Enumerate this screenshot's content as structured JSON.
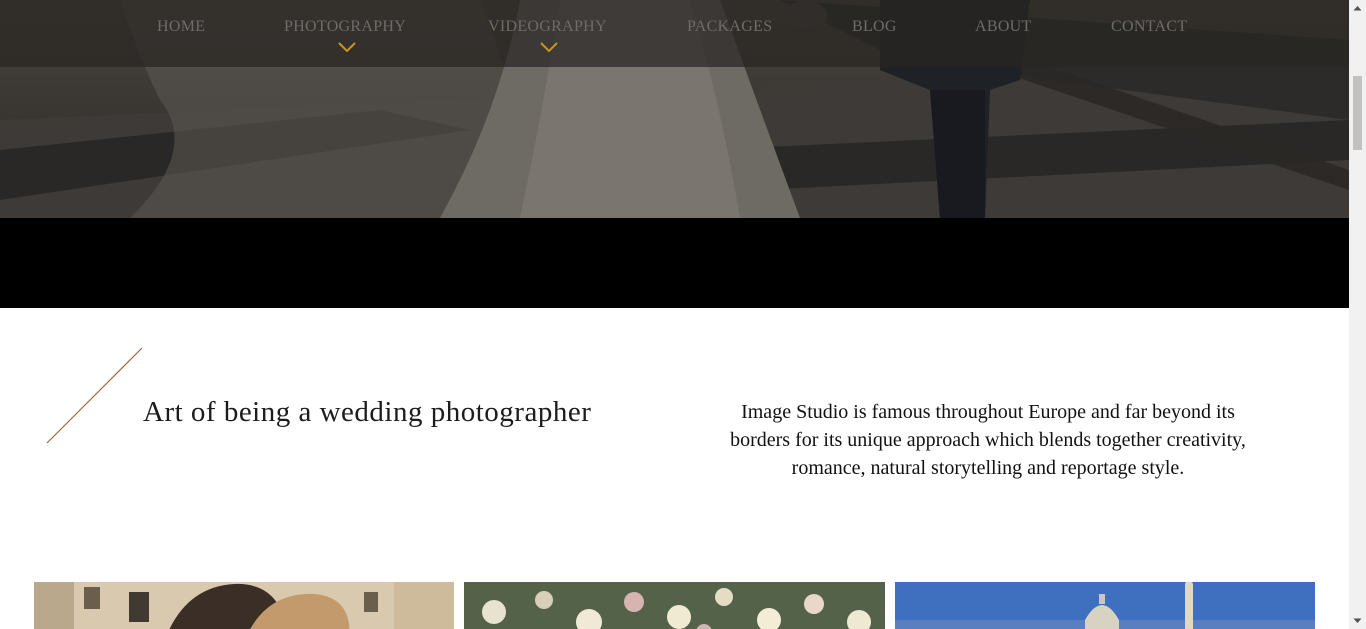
{
  "nav": {
    "items": [
      {
        "label": "HOME"
      },
      {
        "label": "PHOTOGRAPHY"
      },
      {
        "label": "VIDEOGRAPHY"
      },
      {
        "label": "PACKAGES"
      },
      {
        "label": "BLOG"
      },
      {
        "label": "ABOUT"
      },
      {
        "label": "CONTACT"
      }
    ],
    "dropdown_icon": "chevron-down-icon",
    "accent_color": "#c8941f"
  },
  "intro": {
    "title": "Art of being a wedding photographer",
    "text": "Image Studio is famous throughout Europe and far beyond its borders for its unique approach which blends together creativity, romance, natural storytelling and reportage style.",
    "line_color": "#9a6a3e"
  },
  "gallery": {
    "items": [
      "couple-photo",
      "flowers-photo",
      "rome-cathedral-photo"
    ]
  }
}
